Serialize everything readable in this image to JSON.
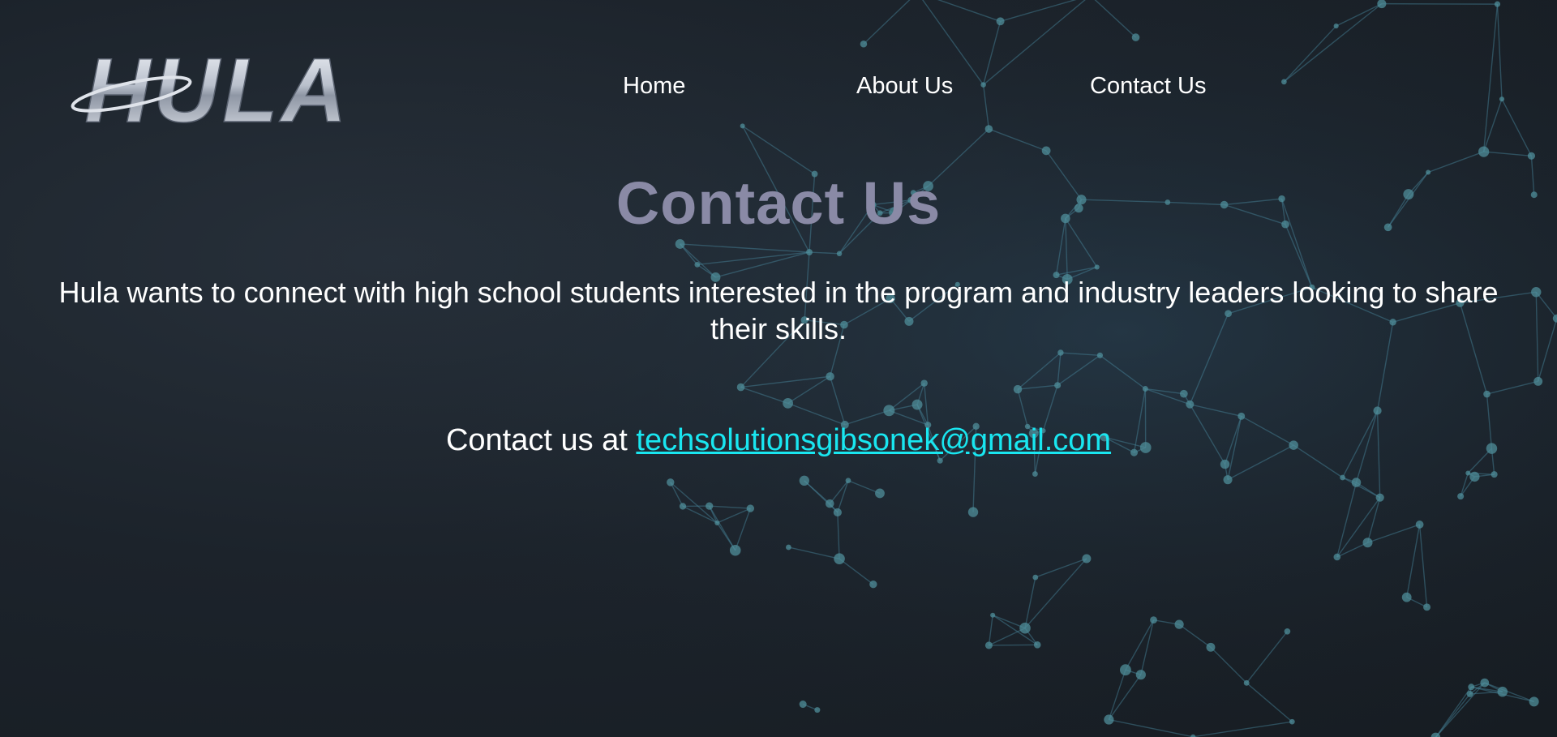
{
  "brand": {
    "logo_text": "HULA"
  },
  "nav": {
    "items": [
      {
        "label": "Home"
      },
      {
        "label": "About Us"
      },
      {
        "label": "Contact Us"
      }
    ]
  },
  "main": {
    "title": "Contact Us",
    "intro": "Hula wants to connect with high school students interested in the program and industry leaders looking to share their skills.",
    "contact_prefix": "Contact us at ",
    "email": "techsolutionsgibsonek@gmail.com"
  },
  "colors": {
    "background": "#1c232b",
    "title": "#8a8aa6",
    "link": "#19e6f0",
    "network": "#4a8aa0"
  },
  "icons": {
    "background": "network-globe-graphic"
  }
}
